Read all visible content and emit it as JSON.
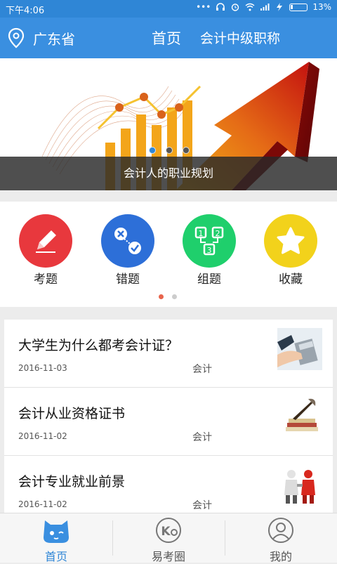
{
  "status_bar": {
    "time": "下午4:06",
    "battery": "13%"
  },
  "header": {
    "location": "广东省",
    "title": "首页",
    "subject": "会计中级职称"
  },
  "banner": {
    "caption": "会计人的职业规划",
    "slides": 3,
    "active_slide": 1
  },
  "menu": {
    "items": [
      {
        "label": "考题",
        "icon": "pencil-icon",
        "color": "#e8383d"
      },
      {
        "label": "错题",
        "icon": "wrong-check-icon",
        "color": "#2d6fd8"
      },
      {
        "label": "组题",
        "icon": "numbered-blocks-icon",
        "color": "#1fcf6c"
      },
      {
        "label": "收藏",
        "icon": "star-icon",
        "color": "#f2d21b"
      }
    ],
    "pages": 2,
    "active_page": 1
  },
  "news": [
    {
      "title": "大学生为什么都考会计证？",
      "date": "2016-11-03",
      "tag": "会计",
      "thumb": "calculator-hand-icon"
    },
    {
      "title": "会计从业资格证书",
      "date": "2016-11-02",
      "tag": "会计",
      "thumb": "books-pen-icon"
    },
    {
      "title": "会计专业就业前景",
      "date": "2016-11-02",
      "tag": "会计",
      "thumb": "handshake-figures-icon"
    }
  ],
  "tabs": [
    {
      "label": "首页",
      "icon": "cat-face-icon",
      "active": true
    },
    {
      "label": "易考圈",
      "icon": "ko-circle-icon",
      "active": false
    },
    {
      "label": "我的",
      "icon": "person-icon",
      "active": false
    }
  ],
  "colors": {
    "primary": "#3a8fe0",
    "accent": "#2f86d6"
  }
}
